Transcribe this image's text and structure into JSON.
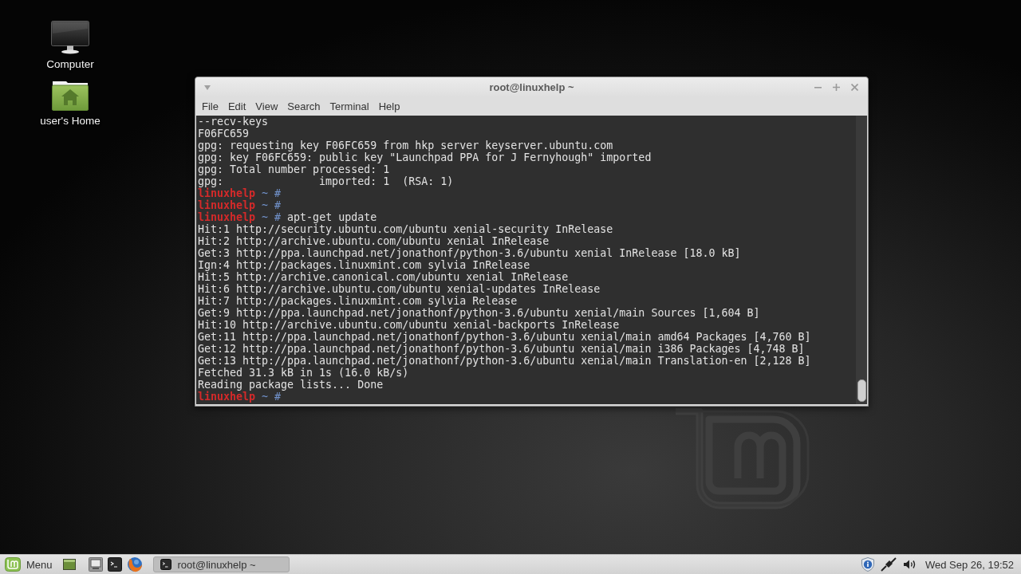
{
  "desktop": {
    "icons": [
      {
        "kind": "computer",
        "label": "Computer"
      },
      {
        "kind": "home",
        "label": "user's Home"
      }
    ]
  },
  "terminal_window": {
    "title": "root@linuxhelp ~",
    "menu": [
      "File",
      "Edit",
      "View",
      "Search",
      "Terminal",
      "Help"
    ],
    "lines": [
      {
        "kind": "output",
        "text": "--recv-keys"
      },
      {
        "kind": "output",
        "text": "F06FC659"
      },
      {
        "kind": "output",
        "text": "gpg: requesting key F06FC659 from hkp server keyserver.ubuntu.com"
      },
      {
        "kind": "output",
        "text": "gpg: key F06FC659: public key \"Launchpad PPA for J Fernyhough\" imported"
      },
      {
        "kind": "output",
        "text": "gpg: Total number processed: 1"
      },
      {
        "kind": "output",
        "text": "gpg:               imported: 1  (RSA: 1)"
      },
      {
        "kind": "prompt",
        "host": "linuxhelp",
        "dir": "~",
        "sign": "#"
      },
      {
        "kind": "prompt",
        "host": "linuxhelp",
        "dir": "~",
        "sign": "#"
      },
      {
        "kind": "prompt",
        "host": "linuxhelp",
        "dir": "~",
        "sign": "#",
        "command": "apt-get update"
      },
      {
        "kind": "output",
        "text": "Hit:1 http://security.ubuntu.com/ubuntu xenial-security InRelease"
      },
      {
        "kind": "output",
        "text": "Hit:2 http://archive.ubuntu.com/ubuntu xenial InRelease"
      },
      {
        "kind": "output",
        "text": "Get:3 http://ppa.launchpad.net/jonathonf/python-3.6/ubuntu xenial InRelease [18.0 kB]"
      },
      {
        "kind": "output",
        "text": "Ign:4 http://packages.linuxmint.com sylvia InRelease"
      },
      {
        "kind": "output",
        "text": "Hit:5 http://archive.canonical.com/ubuntu xenial InRelease"
      },
      {
        "kind": "output",
        "text": "Hit:6 http://archive.ubuntu.com/ubuntu xenial-updates InRelease"
      },
      {
        "kind": "output",
        "text": "Hit:7 http://packages.linuxmint.com sylvia Release"
      },
      {
        "kind": "output",
        "text": "Get:9 http://ppa.launchpad.net/jonathonf/python-3.6/ubuntu xenial/main Sources [1,604 B]"
      },
      {
        "kind": "output",
        "text": "Hit:10 http://archive.ubuntu.com/ubuntu xenial-backports InRelease"
      },
      {
        "kind": "output",
        "text": "Get:11 http://ppa.launchpad.net/jonathonf/python-3.6/ubuntu xenial/main amd64 Packages [4,760 B]"
      },
      {
        "kind": "output",
        "text": "Get:12 http://ppa.launchpad.net/jonathonf/python-3.6/ubuntu xenial/main i386 Packages [4,748 B]"
      },
      {
        "kind": "output",
        "text": "Get:13 http://ppa.launchpad.net/jonathonf/python-3.6/ubuntu xenial/main Translation-en [2,128 B]"
      },
      {
        "kind": "output",
        "text": "Fetched 31.3 kB in 1s (16.0 kB/s)"
      },
      {
        "kind": "output",
        "text": "Reading package lists... Done"
      },
      {
        "kind": "prompt",
        "host": "linuxhelp",
        "dir": "~",
        "sign": "#"
      }
    ]
  },
  "taskbar": {
    "menu_label": "Menu",
    "windows": [
      {
        "title": "root@linuxhelp ~",
        "selected": true
      }
    ],
    "clock": "Wed Sep 26, 19:52"
  }
}
